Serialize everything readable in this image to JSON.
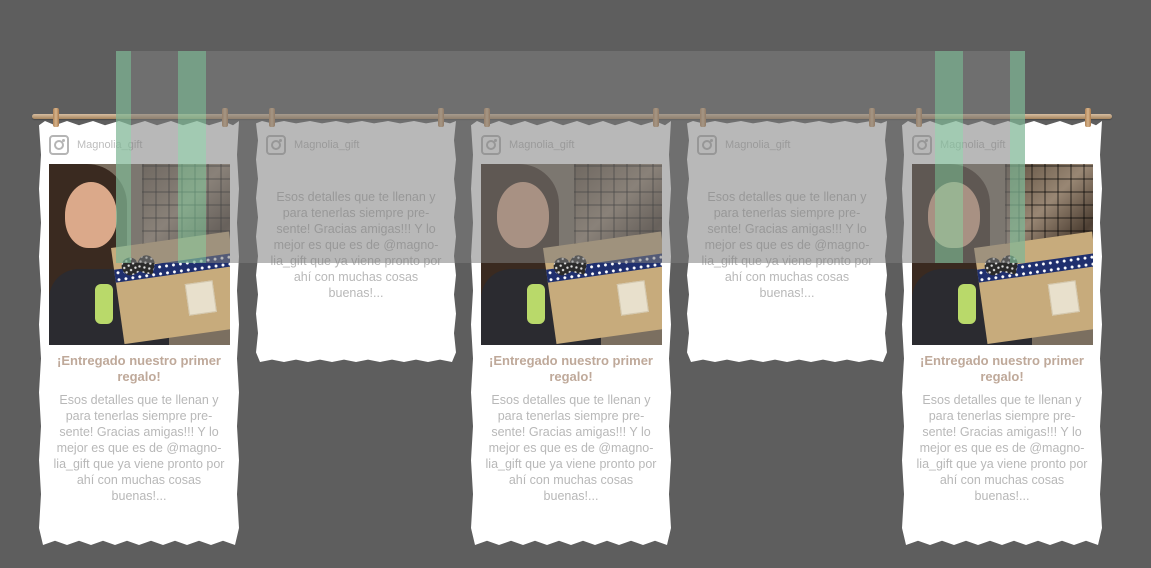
{
  "cards": [
    {
      "type": "photo",
      "username": "Magnolia_gift",
      "title": "¡Entregado nuestro primer regalo!",
      "text": "Esos detalles que te llenan y para tenerlas siempre pre-sente! Gracias amigas!!! Y lo mejor es que es de @magno-lia_gift que ya viene pronto por ahí con muchas cosas buenas!..."
    },
    {
      "type": "text",
      "username": "Magnolia_gift",
      "text": "Esos detalles que te llenan y para tenerlas siempre pre-sente! Gracias amigas!!! Y lo mejor es que es de @magno-lia_gift que ya viene pronto por ahí con muchas cosas buenas!..."
    },
    {
      "type": "photo",
      "username": "Magnolia_gift",
      "title": "¡Entregado nuestro primer regalo!",
      "text": "Esos detalles que te llenan y para tenerlas siempre pre-sente! Gracias amigas!!! Y lo mejor es que es de @magno-lia_gift que ya viene pronto por ahí con muchas cosas buenas!..."
    },
    {
      "type": "text",
      "username": "Magnolia_gift",
      "text": "Esos detalles que te llenan y para tenerlas siempre pre-sente! Gracias amigas!!! Y lo mejor es que es de @magno-lia_gift que ya viene pronto por ahí con muchas cosas buenas!..."
    },
    {
      "type": "photo",
      "username": "Magnolia_gift",
      "title": "¡Entregado nuestro primer regalo!",
      "text": "Esos detalles que te llenan y para tenerlas siempre pre-sente! Gracias amigas!!! Y lo mejor es que es de @magno-lia_gift que ya viene pronto por ahí con muchas cosas buenas!..."
    }
  ],
  "icons": {
    "profile": "instagram-icon",
    "clip": "clothespin-icon"
  },
  "colors": {
    "background": "#5e5e5e",
    "card": "#ffffff",
    "title": "#bfa99a",
    "text": "#b8b8b8",
    "rope": "#c4a57f",
    "highlight": "#82e6aa"
  }
}
